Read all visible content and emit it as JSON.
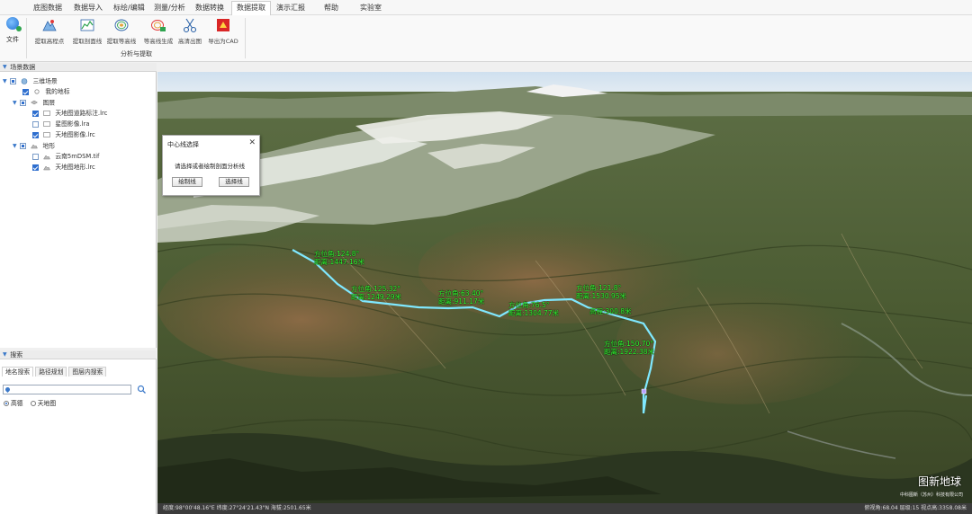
{
  "menu": {
    "items": [
      "底图数据",
      "数据导入",
      "标绘/编辑",
      "测量/分析",
      "数据转换",
      "数据提取",
      "演示汇报",
      "帮助",
      "实验室"
    ],
    "active_index": 5
  },
  "ribbon": {
    "file_label": "文件",
    "tools": [
      {
        "label": "提取高程点",
        "icon": "elevation-point-icon"
      },
      {
        "label": "提取剖面线",
        "icon": "profile-line-icon"
      },
      {
        "label": "提取等高线",
        "icon": "contour-icon"
      },
      {
        "label": "等高线生成",
        "icon": "contour-generate-icon"
      },
      {
        "label": "高清出图",
        "icon": "scissors-icon"
      },
      {
        "label": "导出为CAD",
        "icon": "cad-export-icon"
      }
    ],
    "group_label": "分析与提取"
  },
  "scene_panel": {
    "title": "场景数据",
    "tree": [
      {
        "label": "三维场景",
        "level": 0,
        "state": "part",
        "expanded": true
      },
      {
        "label": "我的地标",
        "level": 1,
        "state": "on"
      },
      {
        "label": "图层",
        "level": 1,
        "state": "part",
        "expanded": true
      },
      {
        "label": "天地图道路标注.lrc",
        "level": 2,
        "state": "on"
      },
      {
        "label": "星图影像.lra",
        "level": 2,
        "state": "off"
      },
      {
        "label": "天地图影像.lrc",
        "level": 2,
        "state": "on"
      },
      {
        "label": "地形",
        "level": 1,
        "state": "part",
        "expanded": true
      },
      {
        "label": "云南5mDSM.tif",
        "level": 2,
        "state": "off"
      },
      {
        "label": "天地图地形.lrc",
        "level": 2,
        "state": "on"
      }
    ]
  },
  "search_panel": {
    "title": "搜索",
    "tabs": [
      "地名搜索",
      "路径规划",
      "图层内搜索"
    ],
    "active_tab": 0,
    "input_value": "",
    "radios": [
      {
        "label": "高德",
        "selected": true
      },
      {
        "label": "天地图",
        "selected": false
      }
    ]
  },
  "dialog": {
    "title": "中心线选择",
    "message": "请选择或者绘制剖面分析线",
    "draw_button": "绘制线",
    "select_button": "选择线"
  },
  "map": {
    "line_color": "#7fe8ff",
    "label_color": "#33ff33",
    "annotations": [
      {
        "line1": "方位角:124.8°",
        "line2": "距离:1447.16米"
      },
      {
        "line1": "方位角:125.32°",
        "line2": "距离:1249.29米"
      },
      {
        "line1": "方位角:63.40°",
        "line2": "距离:911.17米"
      },
      {
        "line1": "方位角:76.5°",
        "line2": "距离:1304.77米"
      },
      {
        "line1": "方位角:121.8°",
        "line2": "距离:1530.95米"
      },
      {
        "line1": "",
        "line2": "高程:300.8米"
      },
      {
        "line1": "方位角:150.70°",
        "line2": "距离:1922.38米"
      }
    ],
    "brand": "图新地球",
    "brand_sub": "中科图新（苏州）科技有限公司",
    "status_left": "经度:98°00'48.16\"E  纬度:27°24'21.43\"N  海拔:2501.65米",
    "status_right": "俯视角:68.04  层级:15  视点高:3358.08米"
  }
}
